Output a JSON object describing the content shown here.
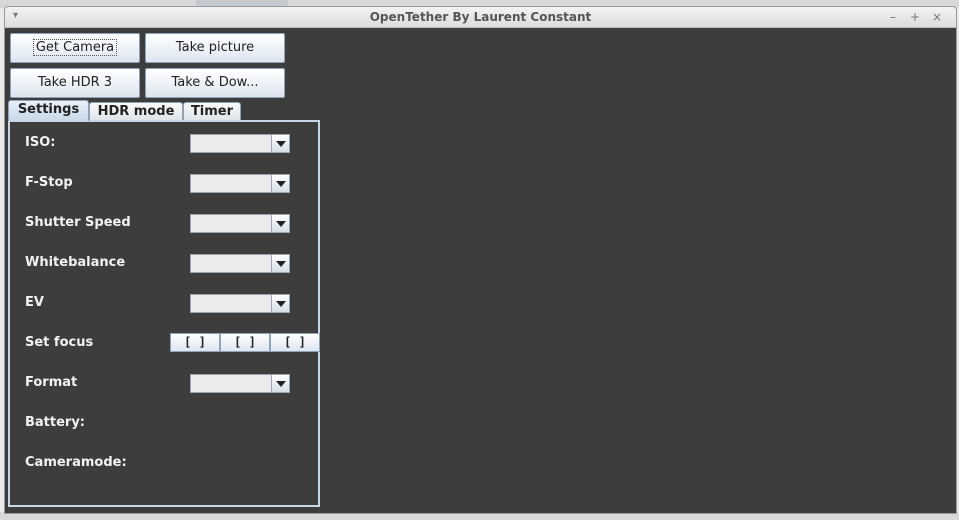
{
  "window": {
    "title": "OpenTether By Laurent Constant",
    "menu_icon": "chevron-down-icon",
    "controls": {
      "minimize": "–",
      "maximize": "+",
      "close": "×"
    }
  },
  "toolbar": {
    "get_camera": "Get Camera",
    "take_picture": "Take picture",
    "take_hdr3": "Take HDR 3",
    "take_download": "Take & Dow..."
  },
  "tabs": [
    {
      "label": "Settings",
      "active": true
    },
    {
      "label": "HDR mode",
      "active": false
    },
    {
      "label": "Timer",
      "active": false
    }
  ],
  "settings": {
    "iso": {
      "label": "ISO:",
      "value": ""
    },
    "fstop": {
      "label": "F-Stop",
      "value": ""
    },
    "shutter": {
      "label": "Shutter Speed",
      "value": ""
    },
    "whitebalance": {
      "label": "Whitebalance",
      "value": ""
    },
    "ev": {
      "label": "EV",
      "value": ""
    },
    "focus": {
      "label": "Set focus",
      "buttons": [
        "[ ]",
        "[ ]",
        "[ ]"
      ]
    },
    "format": {
      "label": "Format",
      "value": ""
    },
    "battery": {
      "label": "Battery:"
    },
    "cameramode": {
      "label": "Cameramode:"
    }
  },
  "colors": {
    "background": "#3d3d3d",
    "panel_border": "#c6d6e6",
    "label_text": "#f2f2f2"
  }
}
